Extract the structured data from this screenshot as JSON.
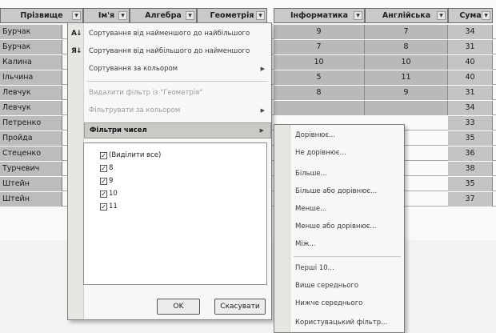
{
  "headers": [
    "Прізвище",
    "Ім'я",
    "Алгебра",
    "Геометрія",
    "Інформатика",
    "Англійська",
    "Сума"
  ],
  "rows": [
    {
      "name": "Бурчак",
      "inf": "9",
      "eng": "7",
      "sum": "34"
    },
    {
      "name": "Бурчак",
      "inf": "7",
      "eng": "8",
      "sum": "31"
    },
    {
      "name": "Калина",
      "inf": "10",
      "eng": "10",
      "sum": "40"
    },
    {
      "name": "Ільчина",
      "inf": "5",
      "eng": "11",
      "sum": "40"
    },
    {
      "name": "Левчук",
      "inf": "8",
      "eng": "9",
      "sum": "31"
    },
    {
      "name": "Левчук",
      "inf": "",
      "eng": "",
      "sum": "34"
    },
    {
      "name": "Петренко",
      "inf": "",
      "eng": "",
      "sum": "33"
    },
    {
      "name": "Пройда",
      "inf": "",
      "eng": "",
      "sum": "35"
    },
    {
      "name": "Стеценко",
      "inf": "",
      "eng": "",
      "sum": "36"
    },
    {
      "name": "Турчевич",
      "inf": "",
      "eng": "",
      "sum": "38"
    },
    {
      "name": "Штейн",
      "inf": "",
      "eng": "",
      "sum": "35"
    },
    {
      "name": "Штейн",
      "inf": "",
      "eng": "",
      "sum": "37"
    }
  ],
  "menu": {
    "sort_asc": "Сортування від найменшого до найбільшого",
    "sort_desc": "Сортування від найбільшого до найменшого",
    "sort_color": "Сортування за кольором",
    "clear_filter": "Видалити фільтр із \"Геометрія\"",
    "filter_color": "Фільтрувати за кольором",
    "number_filters": "Фільтри чисел",
    "select_all": "(Виділити все)",
    "values": [
      "8",
      "9",
      "10",
      "11"
    ],
    "ok": "OK",
    "cancel": "Скасувати"
  },
  "submenu": [
    "Дорівнює...",
    "Не дорівнює...",
    "Більше...",
    "Більше або дорівнює...",
    "Менше...",
    "Менше або дорівнює...",
    "Між...",
    "Перші 10...",
    "Вище середнього",
    "Нижче середнього",
    "Користувацький фільтр..."
  ]
}
